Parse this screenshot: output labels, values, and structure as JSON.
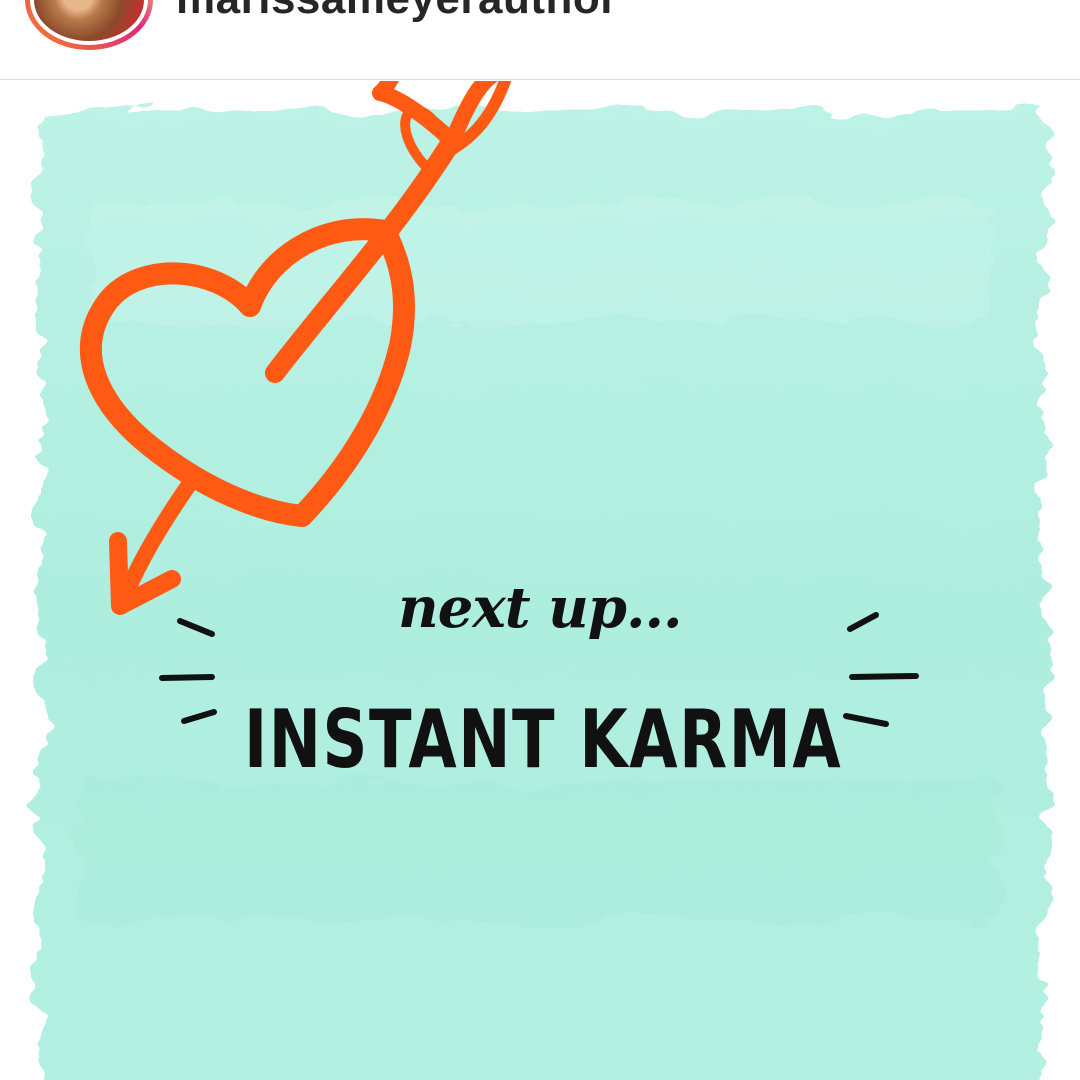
{
  "header": {
    "username": "marissameyerauthor",
    "ring_colors": [
      "#f58529",
      "#dd2a7b",
      "#feda77"
    ]
  },
  "post": {
    "subtitle": "next up...",
    "headline": "INSTANT KARMA",
    "background_color": "#aeeedd",
    "heart_color": "#ff5a14",
    "text_color": "#111111",
    "icons": [
      "heart-with-arrow-icon",
      "emphasis-dashes-icon"
    ]
  }
}
